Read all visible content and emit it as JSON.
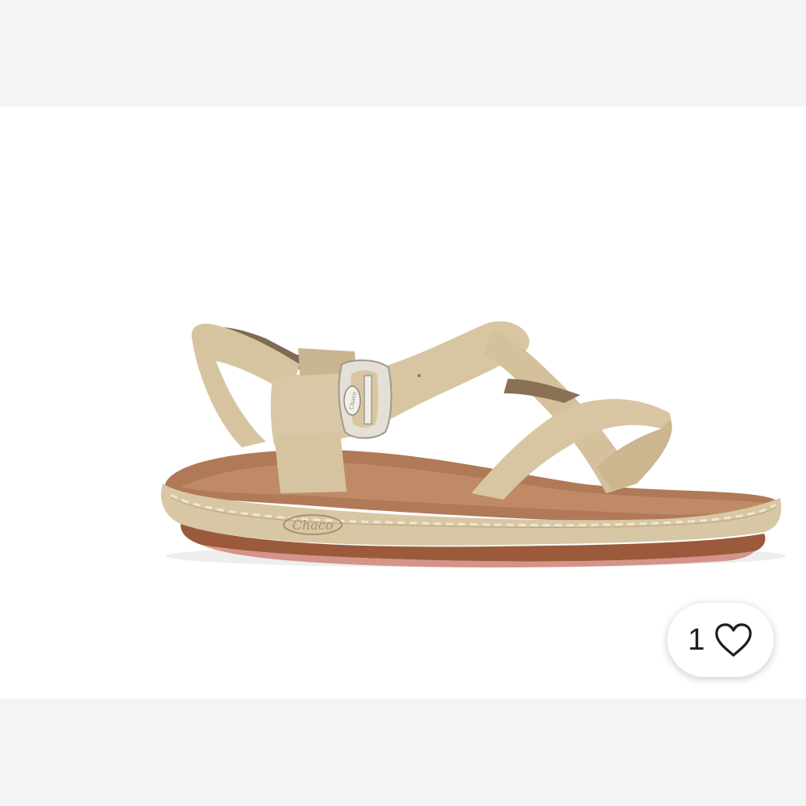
{
  "listing": {
    "image": {
      "subject_icon": "sandal-photo",
      "logo_text": "Chaco"
    },
    "likes": {
      "count": "1",
      "icon": "heart-outline-icon"
    }
  },
  "colors": {
    "page_bg": "#f4f4f4",
    "photo_bg": "#ffffff",
    "strap": "#d8c6a3",
    "footbed": "#b07a58",
    "outsole": "#9b5a3c"
  }
}
